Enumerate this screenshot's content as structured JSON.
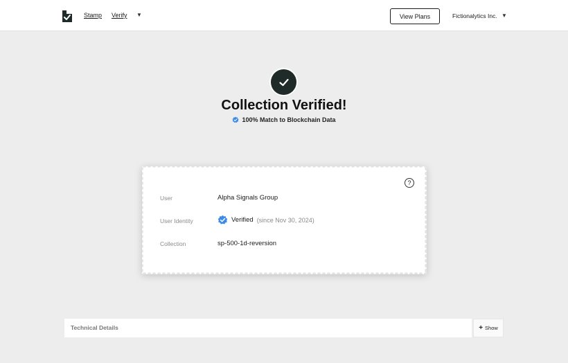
{
  "nav": {
    "stamp_label": "Stamp",
    "verify_label": "Verify",
    "menu_caret": "▼"
  },
  "header_right": {
    "view_plans_label": "View Plans",
    "org_name": "Fictionalytics Inc.",
    "org_caret": "▼"
  },
  "hero": {
    "title": "Collection Verified!",
    "subtitle": "100% Match to Blockchain Data"
  },
  "card": {
    "help_label": "?",
    "rows": [
      {
        "label": "User",
        "value": "Alpha Signals Group"
      },
      {
        "label": "User Identity",
        "status": "Verified",
        "since": "(since Nov 30, 2024)"
      },
      {
        "label": "Collection",
        "value": "sp-500-1d-reversion"
      }
    ]
  },
  "technical": {
    "label": "Technical Details",
    "show_plus": "+",
    "show_label": "Show"
  },
  "colors": {
    "accent_dark": "#1e2b29",
    "verified_blue": "#3d8be8",
    "page_bg": "#ededed"
  },
  "icons": {
    "logo": "brand-logo-icon",
    "hero_check": "checkmark-icon",
    "sub_badge": "verified-badge-icon",
    "identity_badge": "verified-badge-icon",
    "help": "help-icon",
    "show": "plus-icon"
  }
}
